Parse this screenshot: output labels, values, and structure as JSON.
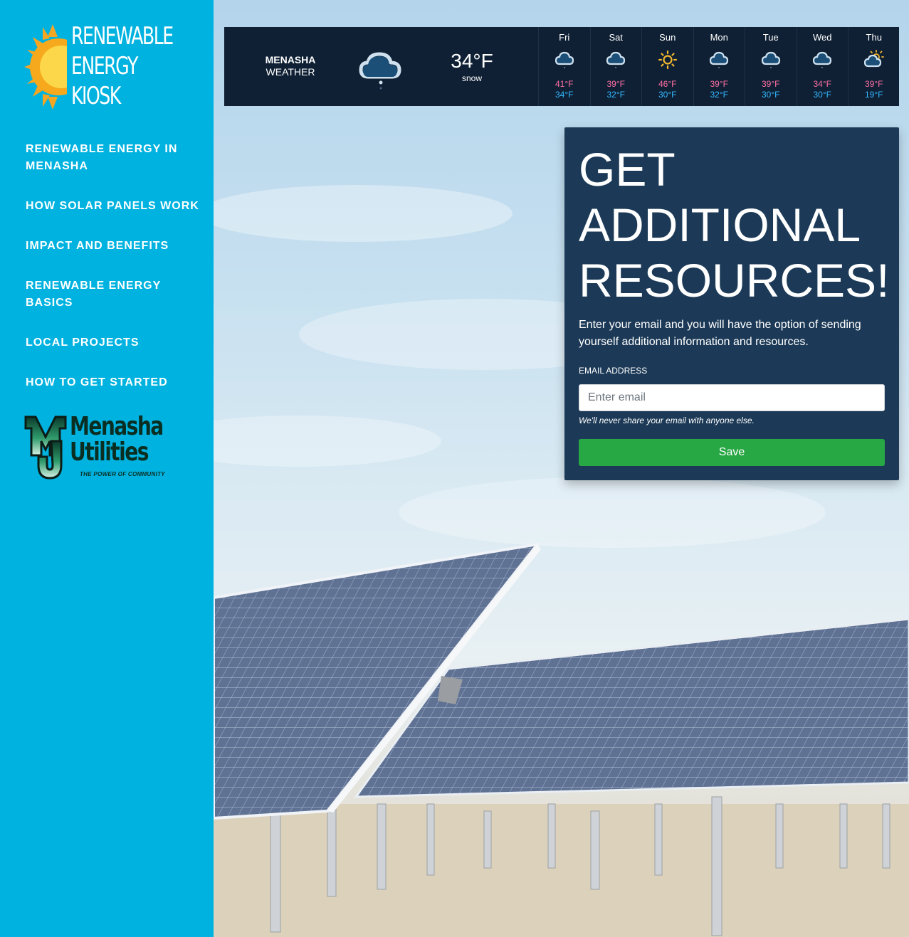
{
  "sidebar": {
    "logo_lines": [
      "RENEWABLE",
      "ENERGY",
      "KIOSK"
    ],
    "nav": [
      {
        "label": "RENEWABLE ENERGY IN MENASHA"
      },
      {
        "label": "HOW SOLAR PANELS WORK"
      },
      {
        "label": "IMPACT AND BENEFITS"
      },
      {
        "label": "RENEWABLE ENERGY BASICS"
      },
      {
        "label": "LOCAL PROJECTS"
      },
      {
        "label": "HOW TO GET STARTED"
      }
    ],
    "partner_logo": {
      "name_line1": "Menasha",
      "name_line2": "Utilities",
      "tagline": "THE POWER OF COMMUNITY"
    }
  },
  "weather": {
    "city": "MENASHA",
    "label": "WEATHER",
    "current_temp": "34°F",
    "current_condition": "snow",
    "current_icon": "snow-cloud-icon",
    "forecast": [
      {
        "day": "Fri",
        "icon": "cloud-icon",
        "high": "41°F",
        "low": "34°F"
      },
      {
        "day": "Sat",
        "icon": "cloud-icon",
        "high": "39°F",
        "low": "32°F"
      },
      {
        "day": "Sun",
        "icon": "sun-icon",
        "high": "46°F",
        "low": "30°F"
      },
      {
        "day": "Mon",
        "icon": "cloud-icon",
        "high": "39°F",
        "low": "32°F"
      },
      {
        "day": "Tue",
        "icon": "cloud-icon",
        "high": "39°F",
        "low": "30°F"
      },
      {
        "day": "Wed",
        "icon": "cloud-icon",
        "high": "34°F",
        "low": "30°F"
      },
      {
        "day": "Thu",
        "icon": "partly-sunny-icon",
        "high": "39°F",
        "low": "19°F"
      }
    ],
    "colors": {
      "background": "#0f2034",
      "high": "#ff6fa3",
      "low": "#33b8ff",
      "sun": "#f5b82e"
    }
  },
  "panel": {
    "title": "GET ADDITIONAL RESOURCES!",
    "description": "Enter your email and you will have the option of sending yourself additional information and resources.",
    "email_label": "EMAIL ADDRESS",
    "email_placeholder": "Enter email",
    "email_value": "",
    "help_text": "We'll never share your email with anyone else.",
    "save_label": "Save"
  },
  "colors": {
    "sidebar": "#00b2df",
    "panel": "#1c3a57",
    "save_button": "#28a745"
  }
}
